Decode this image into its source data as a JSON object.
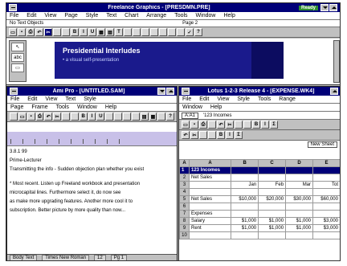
{
  "freelance": {
    "title": "Freelance Graphics - [PRESDMN.PRE]",
    "ready": "Ready",
    "menu": [
      "File",
      "Edit",
      "View",
      "Page",
      "Style",
      "Text",
      "Chart",
      "Arrange",
      "Tools",
      "Window",
      "Help"
    ],
    "status_left": "No Text Objects",
    "status_mid": "Page 2",
    "toolbar_icons": [
      "open-icon",
      "save-icon",
      "print-icon",
      "undo-icon",
      "cut-icon",
      "copy-icon",
      "paste-icon",
      "bold-icon",
      "italic-icon",
      "underline-icon",
      "chart-icon",
      "table-icon",
      "text-icon",
      "symbol-icon",
      "group-icon",
      "ungroup-icon",
      "align-icon",
      "front-icon",
      "back-icon",
      "color-icon",
      "check-icon",
      "help-icon"
    ],
    "slide_tools": [
      "↖",
      "abc",
      "▭"
    ],
    "slide_title": "Presidential Interludes",
    "slide_subtitle": "• a visual self-presentation"
  },
  "amipro": {
    "title": "Ami Pro - [UNTITLED.SAM]",
    "menu1": [
      "File",
      "Edit",
      "View",
      "Text",
      "Style"
    ],
    "menu2": [
      "Page",
      "Frame",
      "Tools",
      "Window",
      "Help"
    ],
    "toolbar_icons": [
      "new-icon",
      "open-icon",
      "save-icon",
      "print-icon",
      "undo-icon",
      "cut-icon",
      "copy-icon",
      "paste-icon",
      "bold-icon",
      "italic-icon",
      "underline-icon",
      "left-align-icon",
      "center-icon",
      "right-align-icon",
      "frame-icon",
      "table-icon",
      "chart-icon",
      "spell-icon",
      "help-icon"
    ],
    "lines": [
      "3.8.1 99",
      "Prime-Lecturer",
      "Transmitting the info - Sudden objection plan whether you exist",
      "",
      "* Most recent. Listen up Freeland workbook and presentation",
      "microcapital lines. Furthermore select it, do now see",
      "as make more upgrading features. Another more cool it to",
      "subscription. Better picture by more quality than now..."
    ],
    "status": [
      "Body Text",
      "Times New Roman",
      "12",
      "Pg 1"
    ]
  },
  "lotus": {
    "title": "Lotus 1-2-3 Release 4 - [EXPENSE.WK4]",
    "menu1": [
      "File",
      "Edit",
      "View",
      "Style",
      "Tools",
      "Range"
    ],
    "menu2": [
      "Window",
      "Help"
    ],
    "cell_ref": "A:A1",
    "cell_value": "'123 Incomes",
    "toolbar_icons": [
      "open-icon",
      "save-icon",
      "print-icon",
      "preview-icon",
      "undo-icon",
      "cut-icon",
      "copy-icon",
      "paste-icon",
      "bold-icon",
      "italic-icon",
      "sum-icon"
    ],
    "sheet_tab": "A",
    "new_sheet": "New Sheet",
    "columns": [
      "A",
      "B",
      "C",
      "D",
      "E"
    ],
    "rows": [
      {
        "n": "1",
        "cells": [
          "123 Incomes",
          "",
          "",
          "",
          ""
        ],
        "header": true
      },
      {
        "n": "2",
        "cells": [
          "Net Sales",
          "",
          "",
          "",
          ""
        ]
      },
      {
        "n": "3",
        "cells": [
          "",
          "Jan",
          "Feb",
          "Mar",
          "Tot"
        ]
      },
      {
        "n": "4",
        "cells": [
          "",
          "",
          "",
          "",
          ""
        ]
      },
      {
        "n": "5",
        "cells": [
          "Net Sales",
          "$10,000",
          "$20,000",
          "$30,000",
          "$60,000"
        ]
      },
      {
        "n": "6",
        "cells": [
          "",
          "",
          "",
          "",
          ""
        ]
      },
      {
        "n": "7",
        "cells": [
          "Expenses",
          "",
          "",
          "",
          ""
        ]
      },
      {
        "n": "8",
        "cells": [
          "Salary",
          "$1,000",
          "$1,000",
          "$1,000",
          "$3,000"
        ]
      },
      {
        "n": "9",
        "cells": [
          "Rent",
          "$1,000",
          "$1,000",
          "$1,000",
          "$3,000"
        ]
      },
      {
        "n": "10",
        "cells": [
          "",
          "",
          "",
          "",
          ""
        ]
      }
    ]
  }
}
